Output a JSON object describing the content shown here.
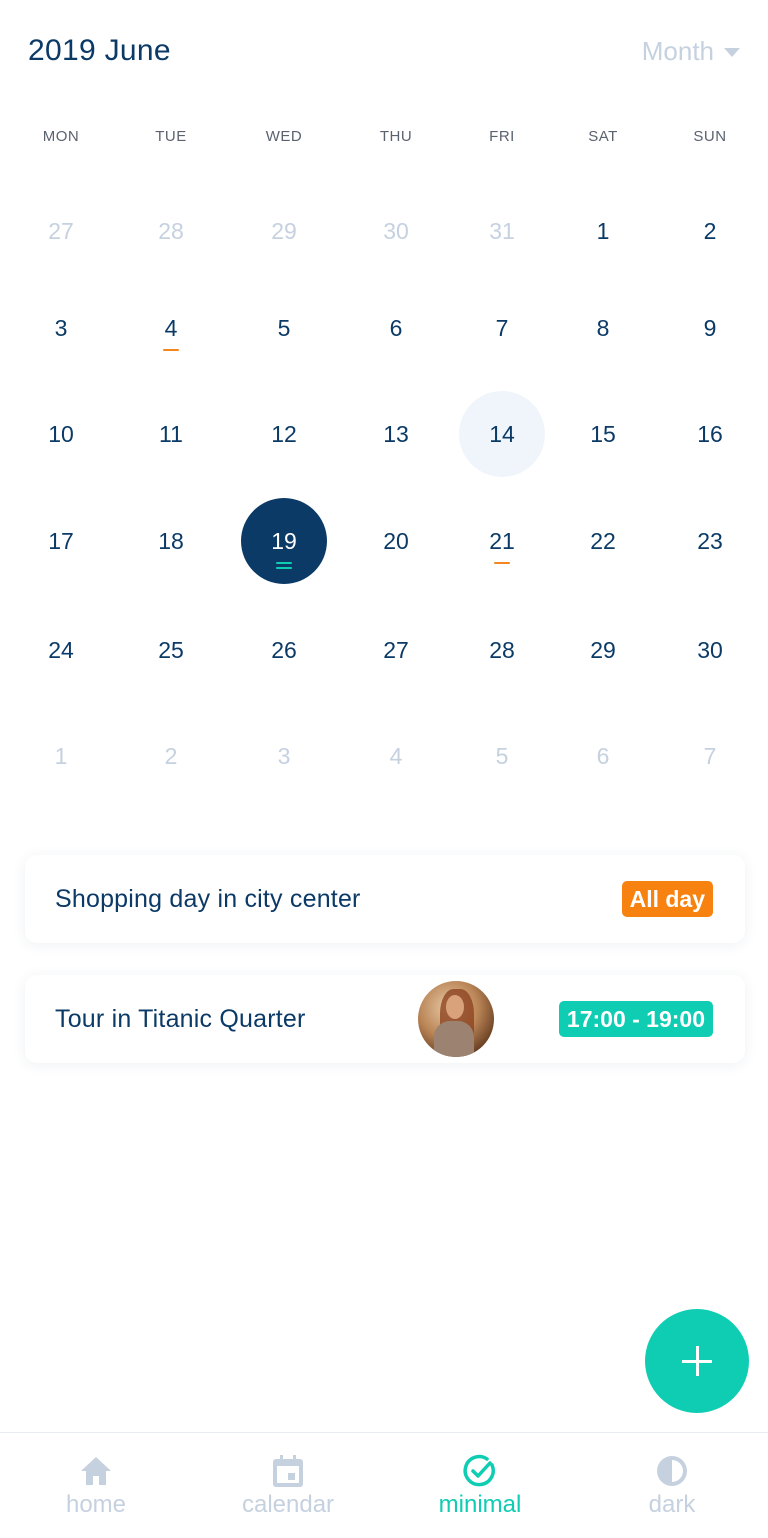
{
  "header": {
    "title": "2019 June",
    "view_select": {
      "label": "Month",
      "icon": "caret-down-icon"
    }
  },
  "weekdays": [
    "MON",
    "TUE",
    "WED",
    "THU",
    "FRI",
    "SAT",
    "SUN"
  ],
  "calendar": {
    "weeks": [
      [
        {
          "day": "27",
          "muted": true
        },
        {
          "day": "28",
          "muted": true
        },
        {
          "day": "29",
          "muted": true
        },
        {
          "day": "30",
          "muted": true
        },
        {
          "day": "31",
          "muted": true
        },
        {
          "day": "1"
        },
        {
          "day": "2"
        }
      ],
      [
        {
          "day": "3"
        },
        {
          "day": "4",
          "marks": [
            "#f4861f"
          ]
        },
        {
          "day": "5"
        },
        {
          "day": "6"
        },
        {
          "day": "7"
        },
        {
          "day": "8"
        },
        {
          "day": "9"
        }
      ],
      [
        {
          "day": "10"
        },
        {
          "day": "11"
        },
        {
          "day": "12"
        },
        {
          "day": "13"
        },
        {
          "day": "14",
          "highlight": true
        },
        {
          "day": "15"
        },
        {
          "day": "16"
        }
      ],
      [
        {
          "day": "17"
        },
        {
          "day": "18"
        },
        {
          "day": "19",
          "selected": true,
          "marks": [
            "#0ecdb3",
            "#0ecdb3"
          ]
        },
        {
          "day": "20"
        },
        {
          "day": "21",
          "marks": [
            "#f4861f"
          ]
        },
        {
          "day": "22"
        },
        {
          "day": "23"
        }
      ],
      [
        {
          "day": "24"
        },
        {
          "day": "25"
        },
        {
          "day": "26"
        },
        {
          "day": "27"
        },
        {
          "day": "28"
        },
        {
          "day": "29"
        },
        {
          "day": "30"
        }
      ],
      [
        {
          "day": "1",
          "muted": true
        },
        {
          "day": "2",
          "muted": true
        },
        {
          "day": "3",
          "muted": true
        },
        {
          "day": "4",
          "muted": true
        },
        {
          "day": "5",
          "muted": true
        },
        {
          "day": "6",
          "muted": true
        },
        {
          "day": "7",
          "muted": true
        }
      ]
    ]
  },
  "events": [
    {
      "title": "Shopping day in city center",
      "badge": "All day",
      "badge_color": "#f7820f",
      "has_avatar": false
    },
    {
      "title": "Tour in Titanic Quarter",
      "badge": "17:00 - 19:00",
      "badge_color": "#0ecdb3",
      "has_avatar": true
    }
  ],
  "fab": {
    "icon": "plus-icon",
    "color": "#0ecdb3"
  },
  "bottom_nav": {
    "items": [
      {
        "label": "home",
        "icon": "home-icon",
        "active": false
      },
      {
        "label": "calendar",
        "icon": "calendar-icon",
        "active": false
      },
      {
        "label": "minimal",
        "icon": "check-circle-icon",
        "active": true
      },
      {
        "label": "dark",
        "icon": "contrast-icon",
        "active": false
      }
    ]
  },
  "colors": {
    "primary": "#0b3a66",
    "accent": "#0ecdb3",
    "orange": "#f7820f",
    "muted": "#c6d1e0",
    "highlight_bg": "#f0f5fc"
  }
}
